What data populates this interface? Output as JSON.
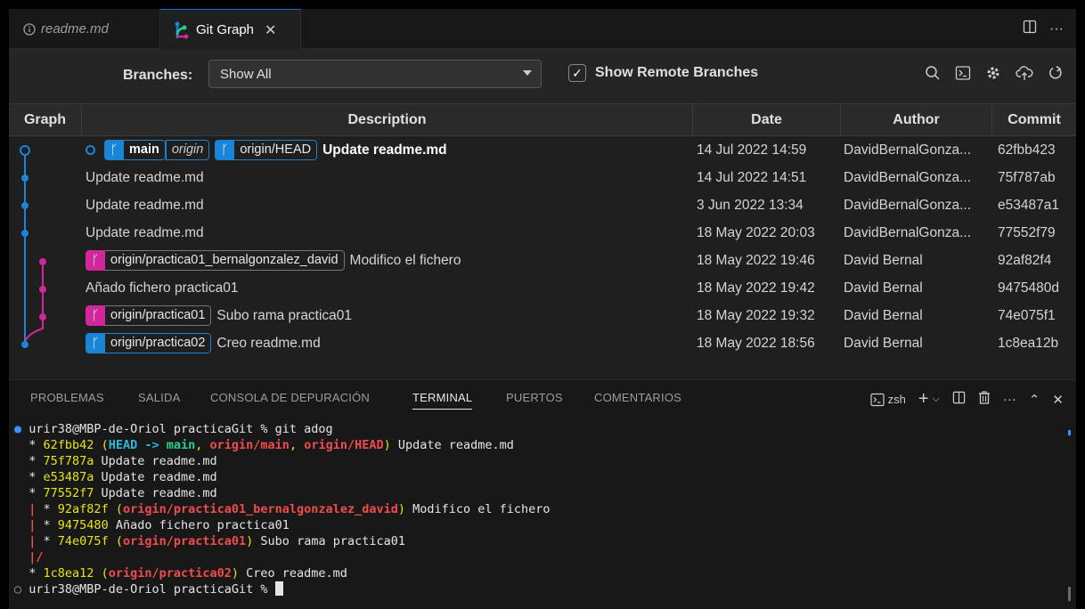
{
  "tabs": [
    {
      "label": "readme.md",
      "icon": "info-icon"
    },
    {
      "label": "Git Graph",
      "icon": "git-graph-icon",
      "active": true
    }
  ],
  "controls": {
    "branches_label": "Branches:",
    "branches_value": "Show All",
    "show_remote_label": "Show Remote Branches",
    "show_remote_checked": true
  },
  "table": {
    "headers": [
      "Graph",
      "Description",
      "Date",
      "Author",
      "Commit"
    ],
    "rows": [
      {
        "subject": "Update readme.md",
        "date": "14 Jul 2022 14:59",
        "author": "DavidBernalGonza...",
        "commit": "62fbb423",
        "refs": [
          "main",
          "origin",
          "origin/HEAD"
        ]
      },
      {
        "subject": "Update readme.md",
        "date": "14 Jul 2022 14:51",
        "author": "DavidBernalGonza...",
        "commit": "75f787ab"
      },
      {
        "subject": "Update readme.md",
        "date": "3 Jun 2022 13:34",
        "author": "DavidBernalGonza...",
        "commit": "e53487a1"
      },
      {
        "subject": "Update readme.md",
        "date": "18 May 2022 20:03",
        "author": "DavidBernalGonza...",
        "commit": "77552f79"
      },
      {
        "subject": "Modifico el fichero",
        "date": "18 May 2022 19:46",
        "author": "David Bernal",
        "commit": "92af82f4",
        "refs": [
          "origin/practica01_bernalgonzalez_david"
        ]
      },
      {
        "subject": "Añado fichero practica01",
        "date": "18 May 2022 19:42",
        "author": "David Bernal",
        "commit": "9475480d"
      },
      {
        "subject": "Subo rama practica01",
        "date": "18 May 2022 19:32",
        "author": "David Bernal",
        "commit": "74e075f1",
        "refs": [
          "origin/practica01"
        ]
      },
      {
        "subject": "Creo readme.md",
        "date": "18 May 2022 18:56",
        "author": "David Bernal",
        "commit": "1c8ea12b",
        "refs": [
          "origin/practica02"
        ]
      }
    ]
  },
  "panel": {
    "tabs": [
      "PROBLEMAS",
      "SALIDA",
      "CONSOLA DE DEPURACIÓN",
      "TERMINAL",
      "PUERTOS",
      "COMENTARIOS"
    ],
    "active_tab": "TERMINAL",
    "shell": "zsh"
  },
  "terminal": {
    "prompt": "urir38@MBP-de-Oriol practicaGit % ",
    "command": "git adog",
    "lines": {
      "l1_hash": "62fbb42",
      "l1_head": "HEAD ->",
      "l1_main": "main",
      "l1_om": "origin/main",
      "l1_oh": "origin/HEAD",
      "l1_msg": " Update readme.md",
      "l2_hash": "75f787a",
      "l2_msg": " Update readme.md",
      "l3_hash": "e53487a",
      "l3_msg": " Update readme.md",
      "l4_hash": "77552f7",
      "l4_msg": " Update readme.md",
      "l5_hash": "92af82f",
      "l5_ref": "origin/practica01_bernalgonzalez_david",
      "l5_msg": " Modifico el fichero",
      "l6_hash": "9475480",
      "l6_msg": " Añado fichero practica01",
      "l7_hash": "74e075f",
      "l7_ref": "origin/practica01",
      "l7_msg": " Subo rama practica01",
      "l9_hash": "1c8ea12",
      "l9_ref": "origin/practica02",
      "l9_msg": " Creo readme.md"
    }
  },
  "colors": {
    "branch_main": "#1a85d6",
    "branch_practica": "#d0279a",
    "accent": "#0078d4"
  }
}
